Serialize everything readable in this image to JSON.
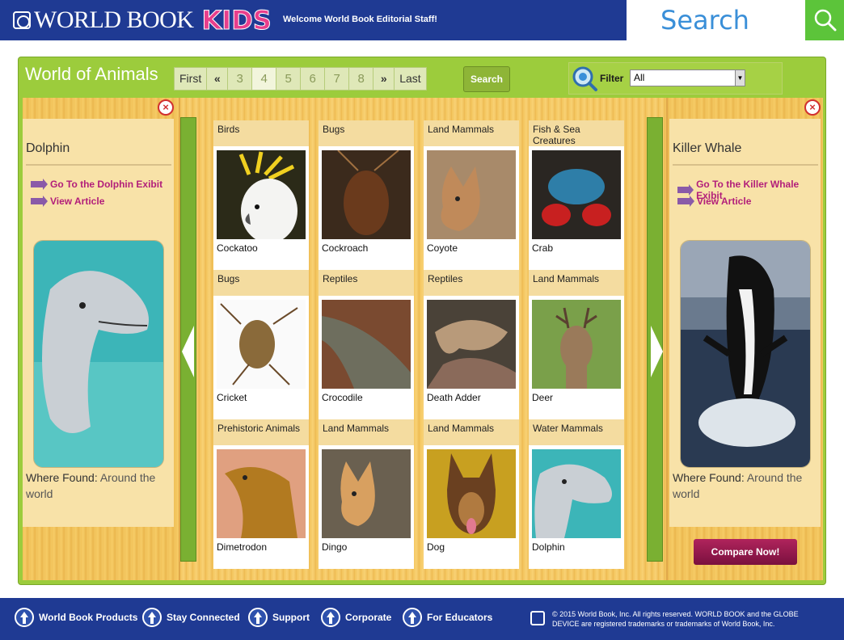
{
  "header": {
    "logo_text": "WORLD BOOK",
    "logo_kids": "KIDS",
    "welcome": "Welcome World Book Editorial Staff!",
    "search_label": "Search"
  },
  "toolbar": {
    "title": "World of Animals",
    "pager": {
      "first": "First",
      "prev": "«",
      "pages": [
        "3",
        "4",
        "5",
        "6",
        "7",
        "8"
      ],
      "current_page": "4",
      "next": "»",
      "last": "Last"
    },
    "search_button": "Search",
    "filter_label": "Filter",
    "filter_value": "All"
  },
  "left_card": {
    "name": "Dolphin",
    "link_exhibit": "Go To the Dolphin Exibit",
    "link_article": "View Article",
    "where_label": "Where Found:",
    "where_value": "Around the world"
  },
  "right_card": {
    "name": "Killer Whale",
    "link_exhibit": "Go To the Killer Whale Exibit",
    "link_article": "View Article",
    "where_label": "Where Found:",
    "where_value": "Around the world"
  },
  "animals": [
    {
      "category": "Birds",
      "name": "Cockatoo"
    },
    {
      "category": "Bugs",
      "name": "Cockroach"
    },
    {
      "category": "Land Mammals",
      "name": "Coyote"
    },
    {
      "category": "Fish & Sea Creatures",
      "name": "Crab"
    },
    {
      "category": "Bugs",
      "name": "Cricket"
    },
    {
      "category": "Reptiles",
      "name": "Crocodile"
    },
    {
      "category": "Reptiles",
      "name": "Death Adder"
    },
    {
      "category": "Land Mammals",
      "name": "Deer"
    },
    {
      "category": "Prehistoric Animals",
      "name": "Dimetrodon"
    },
    {
      "category": "Land Mammals",
      "name": "Dingo"
    },
    {
      "category": "Land Mammals",
      "name": "Dog"
    },
    {
      "category": "Water Mammals",
      "name": "Dolphin"
    }
  ],
  "compare_button": "Compare Now!",
  "footer": {
    "links": [
      "World Book Products",
      "Stay Connected",
      "Support",
      "Corporate",
      "For Educators"
    ],
    "copyright": "© 2015 World Book, Inc. All rights reserved. WORLD BOOK and the GLOBE DEVICE are registered trademarks or trademarks of World Book, Inc."
  },
  "colors": {
    "header_blue": "#1f3a93",
    "accent_green": "#9ccc3c",
    "kids_pink": "#e83e8c",
    "link_magenta": "#b21e7a"
  }
}
